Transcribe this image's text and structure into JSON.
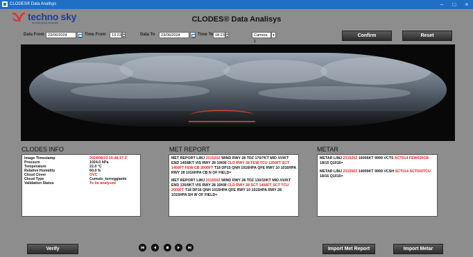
{
  "window": {
    "title": "CLODES® Data Analisys",
    "minimize": "–",
    "maximize": "□",
    "close": "×"
  },
  "brand": {
    "name": "techno sky",
    "tagline": "an enav group company"
  },
  "app_title": "CLODES® Data Analisys",
  "filters": {
    "date_from_label": "Data From",
    "date_from": "23/06/2024",
    "time_from_label": "Time From",
    "time_from": "13:23",
    "date_to_label": "Data To",
    "date_to": "23/06/2024",
    "time_to_label": "Time To",
    "time_to": "18:23",
    "camera": "Camera 1"
  },
  "buttons": {
    "confirm": "Confirm",
    "reset": "Reset",
    "verify": "Verify",
    "import_met_report": "Import Met Report",
    "import_metar": "Import Metar"
  },
  "clodes_info": {
    "title": "CLODES INFO",
    "rows": [
      {
        "key": "Image Timestamp",
        "value": "2024/06/23 15:48:37 Z",
        "color": "#e02020"
      },
      {
        "key": "Pressure",
        "value": "1024.0 hPa",
        "color": "#111111"
      },
      {
        "key": "Temperature",
        "value": "22.0 °C",
        "color": "#111111"
      },
      {
        "key": "Relative Humidity",
        "value": "60.0 %",
        "color": "#111111"
      },
      {
        "key": "Cloud Cover",
        "value": "OVC",
        "color": "#e02020"
      },
      {
        "key": "Cloud Type",
        "value": "Cumulo_torreggiante",
        "color": "#111111"
      },
      {
        "key": "Validation Status",
        "value": "To be analysed",
        "color": "#e02020"
      }
    ]
  },
  "met_report": {
    "title": "MET REPORT",
    "entries": [
      {
        "p1": "MET REPORT LIMJ ",
        "time": "231520Z",
        "p2": " WIND RWY 28 TDZ 170/7KT MID //////KT END 140/8KT VIS RWY 28 10KM ",
        "cld": "CLD RWY 28 FEW TCU 1200FT SCT 1400FT FEW CB 2000FT",
        "p3": " T18 DP15 QNH 1016HPA QFE RWY 10 1016HPA RWY 28 1016HPA CB N OF FIELD="
      },
      {
        "p1": "MET REPORT LIMJ ",
        "time": "231550Z",
        "p2": " WIND RWY 28 TDZ 130/10KT MID //////KT END 130/9KT VIS RWY 28 10KM ",
        "cld": "CLD RWY 28 SCT 1400FT SCT TCU 2000FT",
        "p3": " T18 DP16 QNH 1015HPA QFE RWY 10 1015HPA RWY 28 1015HPA SH W OF FIELD="
      }
    ]
  },
  "metar": {
    "title": "METAR",
    "entries": [
      {
        "p1": "METAR LIMJ ",
        "time": "231520Z",
        "p2": " 16006KT 9999 VCTS ",
        "cld": "SCT014 FEW020CB",
        "p3": " 18/15 Q1016="
      },
      {
        "p1": "METAR LIMJ ",
        "time": "231550Z",
        "p2": " 14009KT 9999 VCSH ",
        "cld": "SCT014 SCT020TCU",
        "p3": " 18/16 Q1015="
      }
    ]
  },
  "colors": {
    "titlebar": "#1f6fc4",
    "highlight": "#e02020",
    "background": "#8d8d8d"
  }
}
